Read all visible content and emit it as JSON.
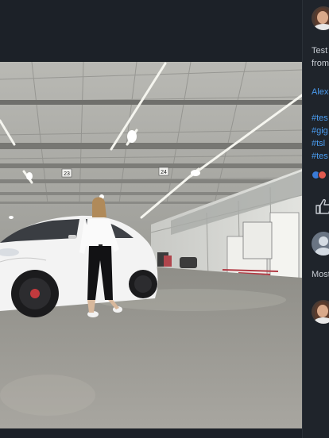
{
  "photo": {
    "sign_left": "23",
    "sign_right": "24"
  },
  "sidebar": {
    "caption_line1": "Test",
    "caption_line2": "from",
    "author_link": "Alex",
    "hashtags": [
      "#tes",
      "#gig",
      "#tsl",
      "#tes"
    ],
    "commenter_text": "Most"
  },
  "colors": {
    "background": "#1c2128",
    "link": "#4a9cf0",
    "text": "#c7ccd3"
  }
}
